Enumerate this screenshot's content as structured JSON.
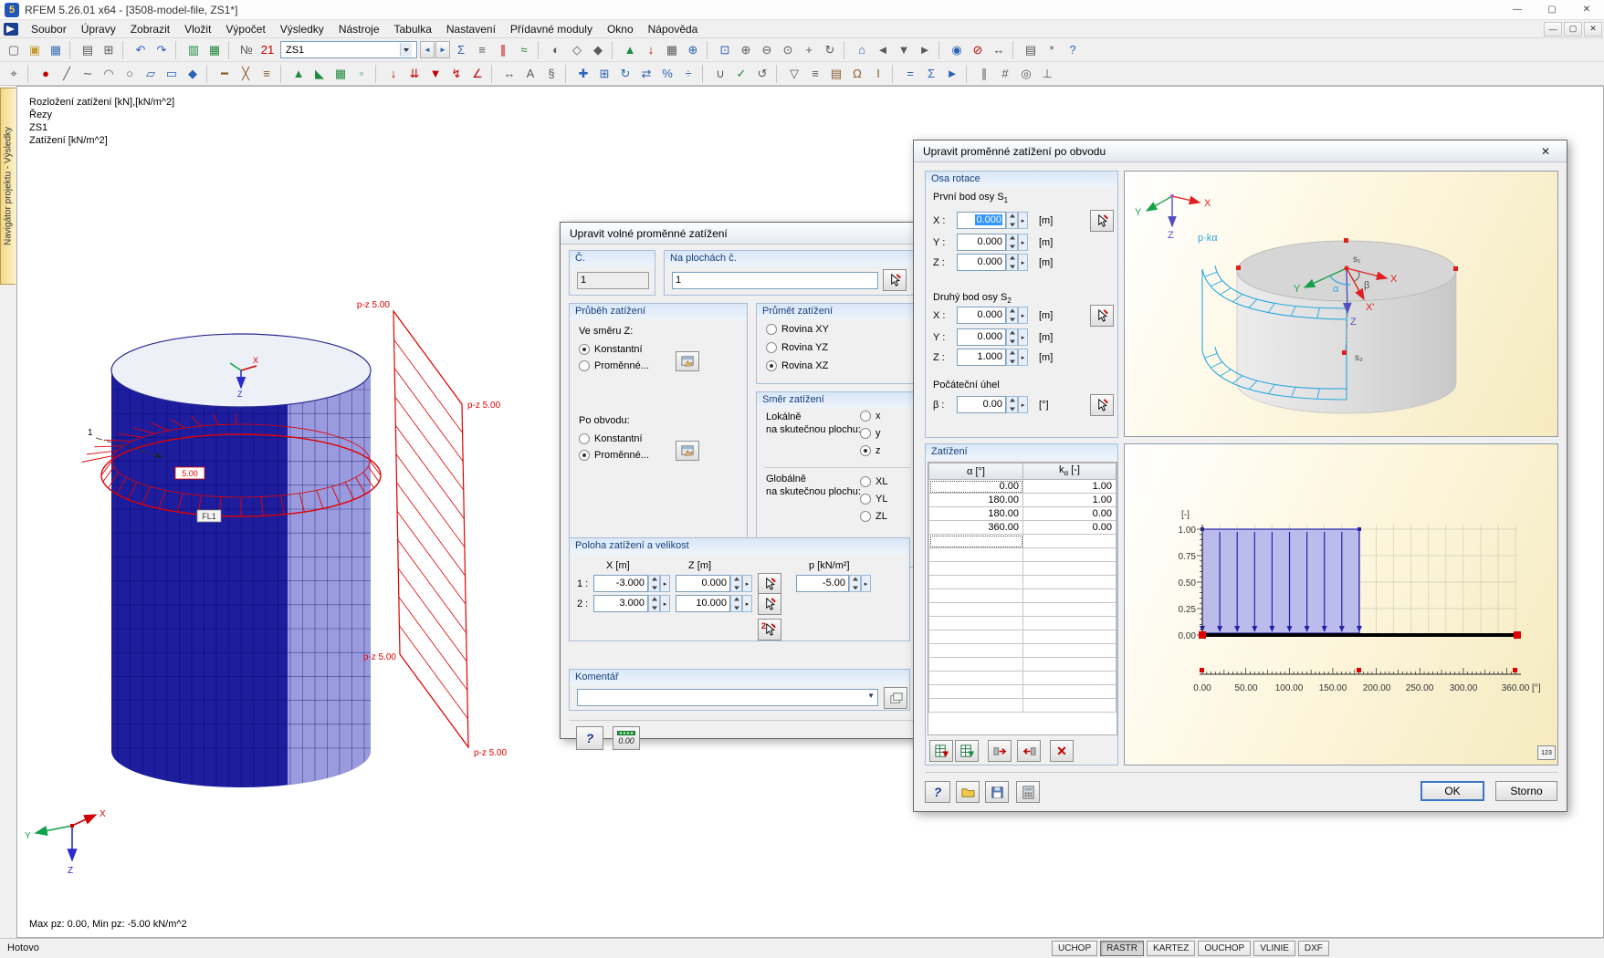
{
  "titlebar": {
    "title": "RFEM 5.26.01 x64 - [3508-model-file, ZS1*]",
    "minimize": "—",
    "maximize": "▢",
    "close": "✕"
  },
  "menubar": {
    "items": [
      "Soubor",
      "Úpravy",
      "Zobrazit",
      "Vložit",
      "Výpočet",
      "Výsledky",
      "Nástroje",
      "Tabulka",
      "Nastavení",
      "Přídavné moduly",
      "Okno",
      "Nápověda"
    ],
    "mdi_minimize": "—",
    "mdi_restore": "▢",
    "mdi_close": "✕"
  },
  "toolbar": {
    "combo_value": "ZS1",
    "prev": "◄",
    "next": "►",
    "row1a": [
      {
        "name": "new-model-icon",
        "glyph": "▢",
        "color": "#5a5a5a"
      },
      {
        "name": "open-icon",
        "glyph": "▣",
        "color": "#c79a30"
      },
      {
        "name": "save-icon",
        "glyph": "▦",
        "color": "#3b6fb5"
      },
      {
        "sep": true
      },
      {
        "name": "print-icon",
        "glyph": "▤",
        "color": "#5a5a5a"
      },
      {
        "name": "copy-icon",
        "glyph": "⊞",
        "color": "#5a5a5a"
      },
      {
        "sep": true
      },
      {
        "name": "undo-icon",
        "glyph": "↶",
        "color": "#2a62b8"
      },
      {
        "name": "redo-icon",
        "glyph": "↷",
        "color": "#2a62b8"
      },
      {
        "sep": true
      },
      {
        "name": "data-panel-icon",
        "glyph": "▥",
        "color": "#1e8a3c"
      },
      {
        "name": "tables-icon",
        "glyph": "▦",
        "color": "#1e8a3c"
      },
      {
        "sep": true
      },
      {
        "name": "numbering-icon",
        "glyph": "№",
        "color": "#5a5a5a"
      },
      {
        "name": "load-case-list-icon",
        "glyph": "21",
        "color": "#c00000"
      }
    ],
    "row1b": [
      {
        "name": "results-toggle-icon",
        "glyph": "Σ",
        "color": "#2a62b8"
      },
      {
        "name": "result-values-icon",
        "glyph": "≡",
        "color": "#5a5a5a"
      },
      {
        "name": "sections-icon",
        "glyph": "∥",
        "color": "#c00000"
      },
      {
        "name": "smooth-ranges-icon",
        "glyph": "≈",
        "color": "#1e8a3c"
      },
      {
        "sep": true
      },
      {
        "name": "solid-render-icon",
        "glyph": "◐",
        "color": "#5a5a5a"
      },
      {
        "name": "wireframe-icon",
        "glyph": "◇",
        "color": "#5a5a5a"
      },
      {
        "name": "shadow-render-icon",
        "glyph": "◆",
        "color": "#5a5a5a"
      },
      {
        "sep": true
      },
      {
        "name": "show-supports-icon",
        "glyph": "▲",
        "color": "#1e8a3c"
      },
      {
        "name": "show-loads-icon",
        "glyph": "↓",
        "color": "#c00000"
      },
      {
        "name": "show-mesh-icon",
        "glyph": "▦",
        "color": "#5a5a5a"
      },
      {
        "name": "show-axes-icon",
        "glyph": "⊕",
        "color": "#2a62b8"
      },
      {
        "sep": true
      },
      {
        "name": "zoom-window-icon",
        "glyph": "⊡",
        "color": "#2a62b8"
      },
      {
        "name": "zoom-in-icon",
        "glyph": "⊕",
        "color": "#5a5a5a"
      },
      {
        "name": "zoom-out-icon",
        "glyph": "⊖",
        "color": "#5a5a5a"
      },
      {
        "name": "zoom-all-icon",
        "glyph": "⊙",
        "color": "#5a5a5a"
      },
      {
        "name": "pan-icon",
        "glyph": "+",
        "color": "#5a5a5a"
      },
      {
        "name": "rotate-view-icon",
        "glyph": "↻",
        "color": "#5a5a5a"
      },
      {
        "sep": true
      },
      {
        "name": "iso-view-icon",
        "glyph": "⌂",
        "color": "#2a62b8"
      },
      {
        "name": "view-x-icon",
        "glyph": "◄",
        "color": "#5a5a5a"
      },
      {
        "name": "view-y-icon",
        "glyph": "▼",
        "color": "#5a5a5a"
      },
      {
        "name": "view-z-icon",
        "glyph": "►",
        "color": "#5a5a5a"
      },
      {
        "sep": true
      },
      {
        "name": "visibility-icon",
        "glyph": "◉",
        "color": "#2a62b8"
      },
      {
        "name": "clipping-icon",
        "glyph": "⊘",
        "color": "#c00000"
      },
      {
        "name": "measure-icon",
        "glyph": "↔",
        "color": "#5a5a5a"
      },
      {
        "sep": true
      },
      {
        "name": "print-graphic-icon",
        "glyph": "▤",
        "color": "#5a5a5a"
      },
      {
        "name": "display-settings-icon",
        "glyph": "*",
        "color": "#5a5a5a"
      },
      {
        "name": "help-icon",
        "glyph": "?",
        "color": "#2a62b8"
      }
    ],
    "row2": [
      {
        "name": "edit-select-icon",
        "glyph": "⌖",
        "color": "#5a5a5a"
      },
      {
        "sep": true
      },
      {
        "name": "node-icon",
        "glyph": "●",
        "color": "#c00000"
      },
      {
        "name": "line-icon",
        "glyph": "╱",
        "color": "#5a5a5a"
      },
      {
        "name": "polyline-icon",
        "glyph": "∼",
        "color": "#5a5a5a"
      },
      {
        "name": "arc-icon",
        "glyph": "◠",
        "color": "#5a5a5a"
      },
      {
        "name": "circle-icon",
        "glyph": "○",
        "color": "#5a5a5a"
      },
      {
        "name": "surface-icon",
        "glyph": "▱",
        "color": "#2a62b8"
      },
      {
        "name": "opening-icon",
        "glyph": "▭",
        "color": "#2a62b8"
      },
      {
        "name": "solid-icon",
        "glyph": "◆",
        "color": "#2a62b8"
      },
      {
        "sep": true
      },
      {
        "name": "member-icon",
        "glyph": "━",
        "color": "#8a5a2a"
      },
      {
        "name": "truss-icon",
        "glyph": "╳",
        "color": "#8a5a2a"
      },
      {
        "name": "rib-icon",
        "glyph": "≡",
        "color": "#8a5a2a"
      },
      {
        "sep": true
      },
      {
        "name": "nodal-support-icon",
        "glyph": "▲",
        "color": "#1e8a3c"
      },
      {
        "name": "line-support-icon",
        "glyph": "◣",
        "color": "#1e8a3c"
      },
      {
        "name": "surface-support-icon",
        "glyph": "▦",
        "color": "#1e8a3c"
      },
      {
        "name": "hinge-icon",
        "glyph": "◦",
        "color": "#1e8a3c"
      },
      {
        "sep": true
      },
      {
        "name": "nodal-load-icon",
        "glyph": "↓",
        "color": "#c00000"
      },
      {
        "name": "line-load-icon",
        "glyph": "⇊",
        "color": "#c00000"
      },
      {
        "name": "surface-load-icon",
        "glyph": "▼",
        "color": "#c00000"
      },
      {
        "name": "free-load-icon",
        "glyph": "↯",
        "color": "#c00000"
      },
      {
        "name": "imperfection-icon",
        "glyph": "∠",
        "color": "#c00000"
      },
      {
        "sep": true
      },
      {
        "name": "dimension-icon",
        "glyph": "↔",
        "color": "#5a5a5a"
      },
      {
        "name": "text-comment-icon",
        "glyph": "A",
        "color": "#5a5a5a"
      },
      {
        "name": "section-cut-icon",
        "glyph": "§",
        "color": "#5a5a5a"
      },
      {
        "sep": true
      },
      {
        "name": "move-icon",
        "glyph": "✚",
        "color": "#2a62b8"
      },
      {
        "name": "copy-object-icon",
        "glyph": "⊞",
        "color": "#2a62b8"
      },
      {
        "name": "rotate-icon",
        "glyph": "↻",
        "color": "#2a62b8"
      },
      {
        "name": "mirror-icon",
        "glyph": "⇄",
        "color": "#2a62b8"
      },
      {
        "name": "scale-icon",
        "glyph": "%",
        "color": "#2a62b8"
      },
      {
        "name": "divide-icon",
        "glyph": "÷",
        "color": "#2a62b8"
      },
      {
        "sep": true
      },
      {
        "name": "connect-lines-icon",
        "glyph": "∪",
        "color": "#5a5a5a"
      },
      {
        "name": "check-model-icon",
        "glyph": "✓",
        "color": "#1e8a3c"
      },
      {
        "name": "regenerate-icon",
        "glyph": "↺",
        "color": "#5a5a5a"
      },
      {
        "sep": true
      },
      {
        "name": "filter-icon",
        "glyph": "▽",
        "color": "#5a5a5a"
      },
      {
        "name": "layers-icon",
        "glyph": "≡",
        "color": "#5a5a5a"
      },
      {
        "name": "library-icon",
        "glyph": "▤",
        "color": "#8a5a2a"
      },
      {
        "name": "material-icon",
        "glyph": "Ω",
        "color": "#8a5a2a"
      },
      {
        "name": "cross-section-icon",
        "glyph": "I",
        "color": "#8a5a2a"
      },
      {
        "sep": true
      },
      {
        "name": "calculate-icon",
        "glyph": "=",
        "color": "#2a62b8"
      },
      {
        "name": "check-results-icon",
        "glyph": "Σ",
        "color": "#2a62b8"
      },
      {
        "name": "animation-icon",
        "glyph": "►",
        "color": "#2a62b8"
      },
      {
        "sep": true
      },
      {
        "name": "guidelines-icon",
        "glyph": "∥",
        "color": "#5a5a5a"
      },
      {
        "name": "grid-icon",
        "glyph": "#",
        "color": "#5a5a5a"
      },
      {
        "name": "snap-icon",
        "glyph": "◎",
        "color": "#5a5a5a"
      },
      {
        "name": "ortho-icon",
        "glyph": "⊥",
        "color": "#5a5a5a"
      }
    ]
  },
  "navigator": "Navigátor projektu - Výsledky",
  "viewport": {
    "info_lines": [
      "Rozložení zatížení [kN],[kN/m^2]",
      "Řezy",
      "ZS1",
      "Zatížení [kN/m^2]"
    ],
    "ring_value": "5.00",
    "surface_label": "FL1",
    "annotation": "1",
    "pz_label": "p-z 5.00",
    "axis_x": "X",
    "axis_y": "Y",
    "axis_z": "Z",
    "status_line": "Max pz: 0.00, Min pz: -5.00 kN/m^2"
  },
  "dialog1": {
    "title": "Upravit volné proměnné zatížení",
    "number": {
      "header": "Č.",
      "value": "1"
    },
    "surfaces": {
      "header": "Na plochách č.",
      "value": "1"
    },
    "course": {
      "header": "Průběh zatížení",
      "dir_label": "Ve směru Z:",
      "r1": "Konstantní",
      "r2": "Proměnné...",
      "perimeter_label": "Po obvodu:",
      "r3": "Konstantní",
      "r4": "Proměnné..."
    },
    "projection": {
      "header": "Průmět zatížení",
      "opt1": "Rovina XY",
      "opt2": "Rovina YZ",
      "opt3": "Rovina XZ"
    },
    "direction": {
      "header": "Směr zatížení",
      "local_l1": "Lokálně",
      "local_l2": "na skutečnou plochu:",
      "x": "x",
      "y": "y",
      "z": "z",
      "global_l1": "Globálně",
      "global_l2": "na skutečnou plochu:",
      "xl": "XL",
      "yl": "YL",
      "zl": "ZL"
    },
    "position": {
      "header": "Poloha zatížení a velikost",
      "col_x": "X  [m]",
      "col_z": "Z  [m]",
      "col_p": "p  [kN/m²]",
      "row1_label": "1 :",
      "row2_label": "2 :",
      "r1x": "-3.000",
      "r1z": "0.000",
      "r1p": "-5.00",
      "r2x": "3.000",
      "r2z": "10.000",
      "picker2_label": "2"
    },
    "comment": {
      "header": "Komentář"
    },
    "footer": {
      "help": "?",
      "units": "0.00"
    }
  },
  "dialog2": {
    "title": "Upravit proměnné zatížení po obvodu",
    "close": "✕",
    "axis": {
      "header": "Osa rotace",
      "p1_label": "První bod osy S",
      "p1_sub": "1",
      "p2_label": "Druhý bod osy S",
      "p2_sub": "2",
      "x_label": "X :",
      "y_label": "Y :",
      "z_label": "Z :",
      "p1": {
        "x": "0.000",
        "y": "0.000",
        "z": "0.000"
      },
      "p2": {
        "x": "0.000",
        "y": "0.000",
        "z": "1.000"
      },
      "unit_m": "[m]",
      "angle_label": "Počáteční úhel",
      "beta_label": "β :",
      "beta": "0.00",
      "unit_deg": "[°]"
    },
    "load": {
      "header": "Zatížení",
      "col_a": "α [°]",
      "col_k": "k",
      "col_k_sub": "α",
      "col_k_unit": "[-]",
      "rows": [
        {
          "a": "0.00",
          "k": "1.00"
        },
        {
          "a": "180.00",
          "k": "1.00"
        },
        {
          "a": "180.00",
          "k": "0.00"
        },
        {
          "a": "360.00",
          "k": "0.00"
        }
      ]
    },
    "preview": {
      "triad_x": "X",
      "triad_y": "Y",
      "triad_z": "Z",
      "pk_label": "p·kα",
      "s1": "s₁",
      "s2": "s₂",
      "alpha": "α",
      "beta": "β",
      "axis_x": "X",
      "axis_xp": "X'",
      "axis_y": "Y",
      "axis_z": "Z"
    },
    "chart": {
      "y_unit": "[-]",
      "x_unit": "[°]",
      "yticks": [
        "1.00",
        "0.75",
        "0.50",
        "0.25",
        "0.00"
      ],
      "xticks": [
        "0.00",
        "50.00",
        "100.00",
        "150.00",
        "200.00",
        "250.00",
        "300.00",
        "360.00"
      ],
      "numeric_button": "123"
    },
    "footer": {
      "ok": "OK",
      "cancel": "Storno"
    }
  },
  "statusbar": {
    "ready": "Hotovo",
    "toggles": [
      {
        "label": "UCHOP",
        "pressed": false
      },
      {
        "label": "RASTR",
        "pressed": true
      },
      {
        "label": "KARTEZ",
        "pressed": false
      },
      {
        "label": "OUCHOP",
        "pressed": false
      },
      {
        "label": "VLINIE",
        "pressed": false
      },
      {
        "label": "DXF",
        "pressed": false
      }
    ]
  }
}
